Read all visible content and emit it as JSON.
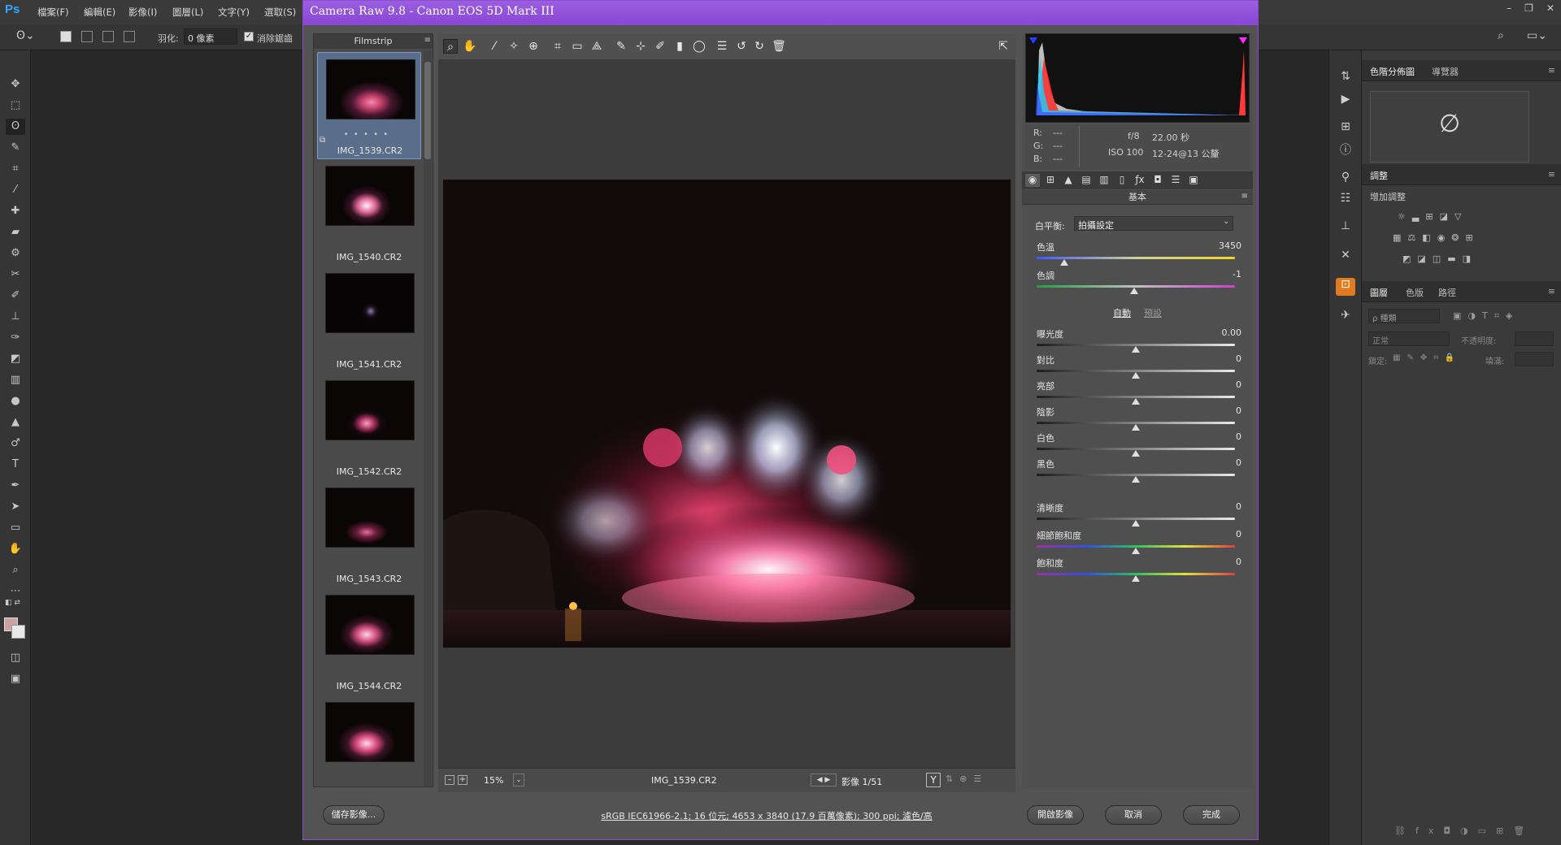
{
  "ps": {
    "logo": "Ps",
    "menus": [
      "檔案(F)",
      "編輯(E)",
      "影像(I)",
      "圖層(L)",
      "文字(Y)",
      "選取(S)"
    ],
    "window_controls": [
      "–",
      "❐",
      "✕"
    ],
    "options": {
      "feather_label": "羽化:",
      "feather_value": "0 像素",
      "antialias_label": "消除鋸齒"
    }
  },
  "acr": {
    "title": "Camera Raw 9.8  -  Canon EOS 5D Mark III",
    "filmstrip": {
      "header": "Filmstrip",
      "thumbs": [
        {
          "label": "IMG_1539.CR2",
          "selected": true,
          "dots": "• • • • •"
        },
        {
          "label": "IMG_1540.CR2"
        },
        {
          "label": "IMG_1541.CR2"
        },
        {
          "label": "IMG_1542.CR2"
        },
        {
          "label": "IMG_1543.CR2"
        },
        {
          "label": "IMG_1544.CR2"
        },
        {
          "label": ""
        }
      ]
    },
    "preview_bar": {
      "zoom": "15%",
      "filename": "IMG_1539.CR2",
      "image_counter": "影像 1/51",
      "y_button": "Y"
    },
    "camera_info": {
      "r_label": "R:",
      "r_value": "---",
      "g_label": "G:",
      "g_value": "---",
      "b_label": "B:",
      "b_value": "---",
      "aperture": "f/8",
      "shutter": "22.00 秒",
      "iso": "ISO 100",
      "lens": "12-24@13 公釐"
    },
    "panel_title": "基本",
    "white_balance": {
      "label": "白平衡:",
      "value": "拍攝設定"
    },
    "temp": {
      "label": "色溫",
      "value": "3450",
      "pos": 0.14
    },
    "tint": {
      "label": "色調",
      "value": "-1",
      "pos": 0.49
    },
    "auto_label": "自動",
    "default_label": "預設",
    "sliders": [
      {
        "label": "曝光度",
        "value": "0.00",
        "pos": 0.5
      },
      {
        "label": "對比",
        "value": "0",
        "pos": 0.5
      },
      {
        "label": "亮部",
        "value": "0",
        "pos": 0.5
      },
      {
        "label": "陰影",
        "value": "0",
        "pos": 0.5
      },
      {
        "label": "白色",
        "value": "0",
        "pos": 0.5
      },
      {
        "label": "黑色",
        "value": "0",
        "pos": 0.5
      }
    ],
    "sliders2": [
      {
        "label": "清晰度",
        "value": "0",
        "pos": 0.5
      },
      {
        "label": "細節飽和度",
        "value": "0",
        "pos": 0.5
      },
      {
        "label": "飽和度",
        "value": "0",
        "pos": 0.5
      }
    ],
    "bottom": {
      "save_button": "儲存影像...",
      "workflow_link": "sRGB IEC61966-2.1; 16 位元; 4653 x 3840 (17.9 百萬像素); 300 ppi; 濾色/高",
      "open_button": "開啟影像",
      "cancel_button": "取消",
      "done_button": "完成"
    }
  },
  "panels": {
    "histogram_tabs": [
      "色階分佈圖",
      "導覽器"
    ],
    "adjust_title": "調整",
    "adjust_subtitle": "增加調整",
    "layers_tabs": [
      "圖層",
      "色版",
      "路徑"
    ],
    "layers_kind": "ρ 種類",
    "blend_mode": "正常",
    "opacity_label": "不透明度:",
    "lock_label": "鎖定:",
    "fill_label": "填滿:"
  },
  "colors": {
    "acr_title": "#8a46d6",
    "ps_blue": "#31a8ff",
    "foreground": "#c9a3a3"
  }
}
